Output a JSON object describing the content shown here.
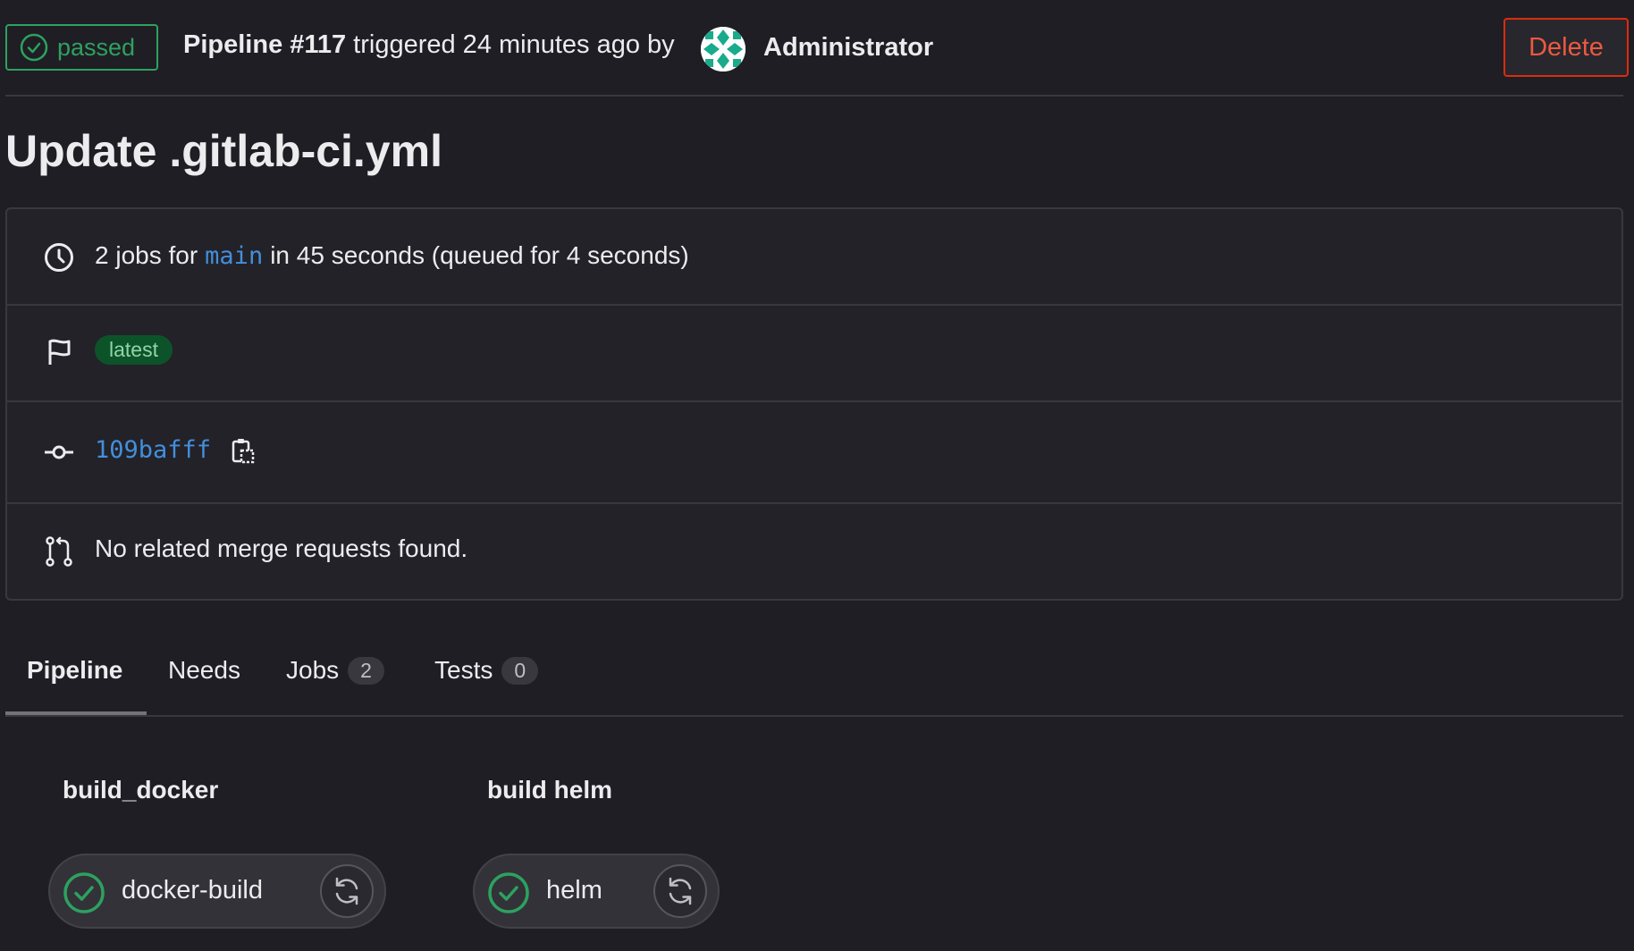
{
  "header": {
    "status_label": "passed",
    "pipeline_label": "Pipeline #117",
    "triggered_text": "triggered 24 minutes ago by",
    "user_name": "Administrator",
    "delete_label": "Delete"
  },
  "title": "Update .gitlab-ci.yml",
  "info": {
    "jobs_prefix": "2 jobs for",
    "branch": "main",
    "jobs_suffix": "in 45 seconds (queued for 4 seconds)",
    "tag": "latest",
    "commit_sha": "109bafff",
    "merge_requests": "No related merge requests found."
  },
  "tabs": [
    {
      "label": "Pipeline",
      "active": true
    },
    {
      "label": "Needs"
    },
    {
      "label": "Jobs",
      "count": "2"
    },
    {
      "label": "Tests",
      "count": "0"
    }
  ],
  "stages": [
    {
      "title": "build_docker",
      "job": "docker-build",
      "status": "success"
    },
    {
      "title": "build helm",
      "job": "helm",
      "status": "success"
    }
  ],
  "colors": {
    "success": "#2da160",
    "link": "#428fdc",
    "danger": "#ec5941"
  },
  "icons": {
    "status": "check-circle-icon",
    "duration": "clock-icon",
    "tag": "flag-icon",
    "commit": "commit-icon",
    "copy": "copy-to-clipboard-icon",
    "merge_request": "merge-request-icon",
    "retry": "retry-icon"
  }
}
